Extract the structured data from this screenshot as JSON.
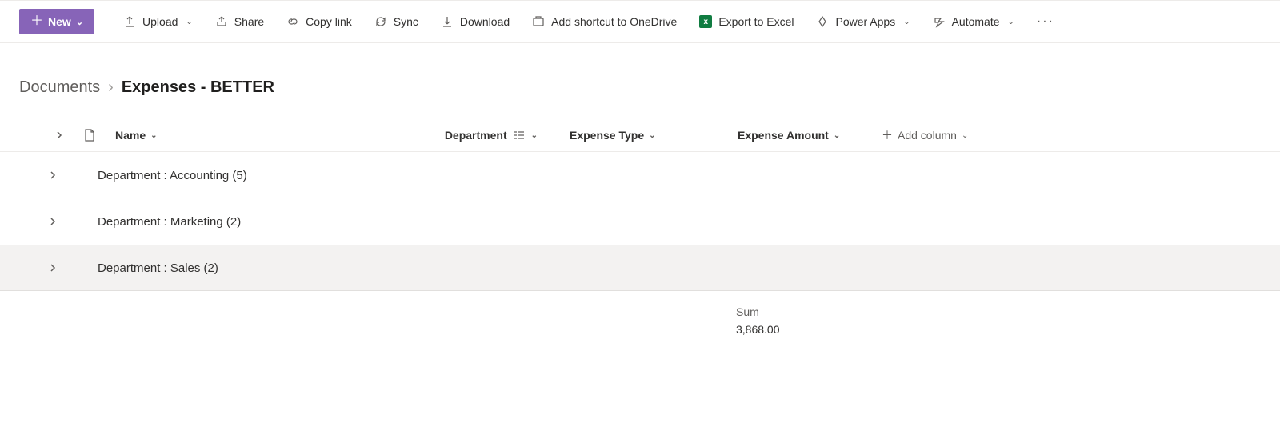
{
  "toolbar": {
    "new_label": "New",
    "upload_label": "Upload",
    "share_label": "Share",
    "copylink_label": "Copy link",
    "sync_label": "Sync",
    "download_label": "Download",
    "shortcut_label": "Add shortcut to OneDrive",
    "export_label": "Export to Excel",
    "powerapps_label": "Power Apps",
    "automate_label": "Automate"
  },
  "breadcrumb": {
    "root": "Documents",
    "current": "Expenses - BETTER"
  },
  "columns": {
    "name": "Name",
    "department": "Department",
    "expense_type": "Expense Type",
    "expense_amount": "Expense Amount",
    "add_column": "Add column"
  },
  "groups": [
    {
      "label": "Department : Accounting (5)"
    },
    {
      "label": "Department : Marketing (2)"
    },
    {
      "label": "Department : Sales (2)"
    }
  ],
  "totals": {
    "label": "Sum",
    "value": "3,868.00"
  }
}
